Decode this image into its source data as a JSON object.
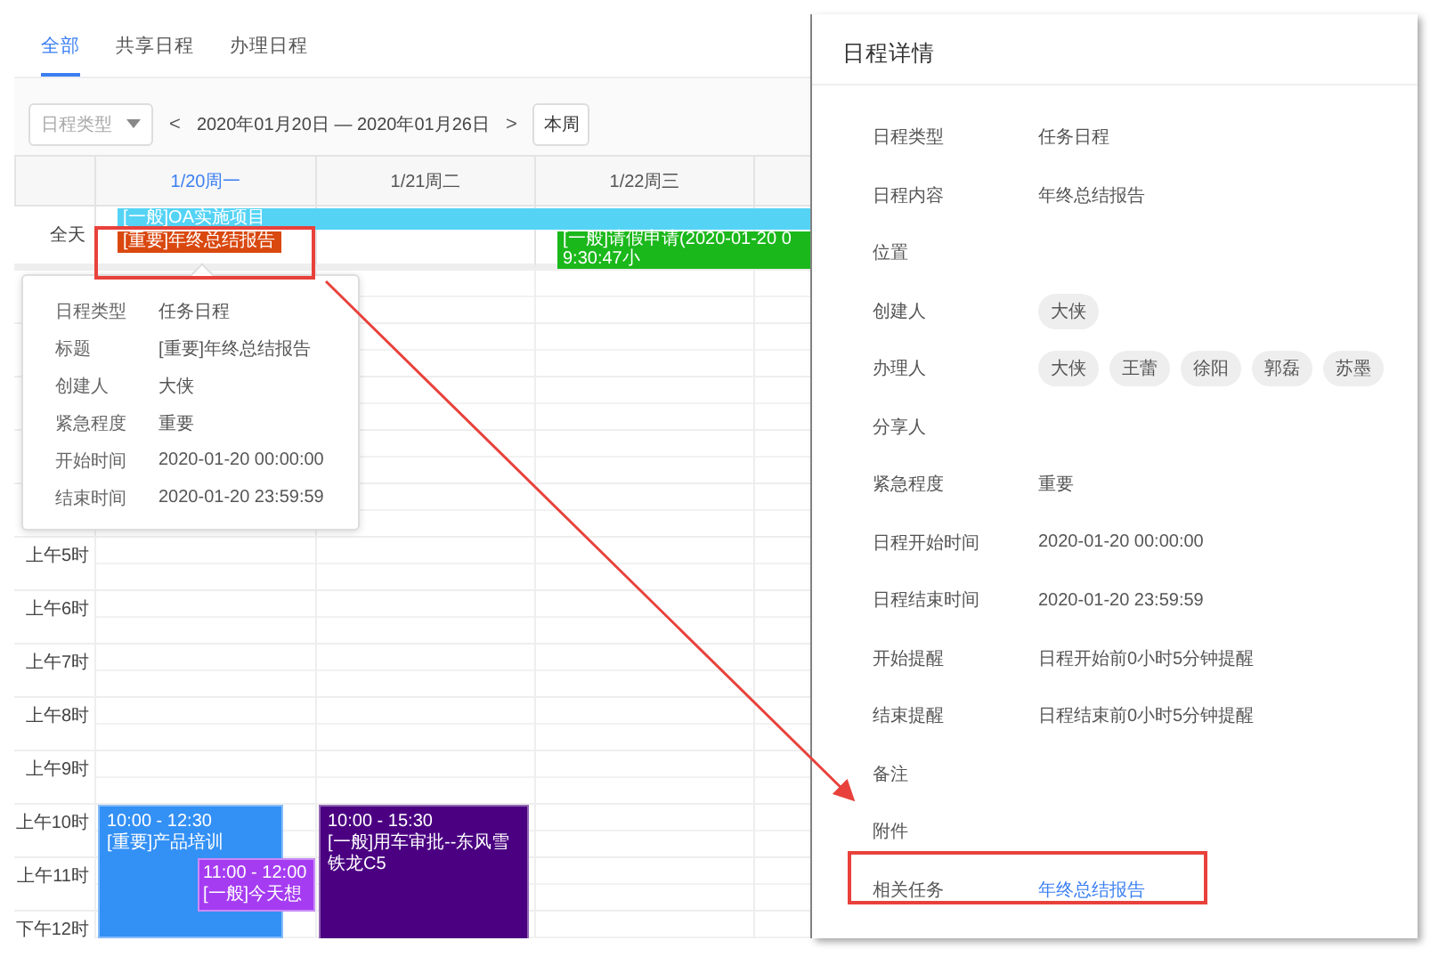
{
  "calendar": {
    "tabs": [
      {
        "label": "全部",
        "selected": true
      },
      {
        "label": "共享日程",
        "selected": false
      },
      {
        "label": "办理日程",
        "selected": false
      }
    ],
    "toolbar": {
      "type_filter": {
        "placeholder": "日程类型"
      },
      "prev": "<",
      "range": "2020年01月20日 — 2020年01月26日",
      "next": ">",
      "this_week": "本周"
    },
    "all_day_label": "全天",
    "days": [
      {
        "label": "1/20周一",
        "today": true,
        "all_day_events": [
          {
            "text": "[一般]OA实施项目",
            "color": "#55d3f5",
            "top_row": true,
            "extends": true
          },
          {
            "text": "[重要]年终总结报告",
            "color": "#d9480f",
            "top_row": false,
            "extends": false
          }
        ],
        "events": [
          {
            "time": "10:00 - 12:30",
            "title": "[重要]产品培训",
            "color": "#3390f5"
          },
          {
            "time": "11:00 - 12:00",
            "title": "[一般]今天想",
            "color": "#a63cf2"
          }
        ]
      },
      {
        "label": "1/21周二",
        "today": false,
        "events": [
          {
            "time": "10:00 - 15:30",
            "title": "[一般]用车审批--东风雪铁龙C5",
            "color": "#4b0082"
          }
        ]
      },
      {
        "label": "1/22周三",
        "today": false,
        "all_day_events": [
          {
            "text": "[一般]请假申请(2020-01-20 09:30:47小",
            "color": "#1bb81b",
            "top_row": false,
            "extends": true
          }
        ]
      }
    ],
    "hours": [
      "上午5时",
      "上午6时",
      "上午7时",
      "上午8时",
      "上午9时",
      "上午10时",
      "上午11时",
      "下午12时"
    ],
    "popover": {
      "fields": [
        {
          "label": "日程类型",
          "value": "任务日程"
        },
        {
          "label": "标题",
          "value": "[重要]年终总结报告"
        },
        {
          "label": "创建人",
          "value": "大侠"
        },
        {
          "label": "紧急程度",
          "value": "重要"
        },
        {
          "label": "开始时间",
          "value": "2020-01-20 00:00:00"
        },
        {
          "label": "结束时间",
          "value": "2020-01-20 23:59:59"
        }
      ]
    }
  },
  "detail_panel": {
    "title": "日程详情",
    "fields": [
      {
        "label": "日程类型",
        "kind": "text",
        "value": "任务日程"
      },
      {
        "label": "日程内容",
        "kind": "text",
        "value": "年终总结报告"
      },
      {
        "label": "位置",
        "kind": "text"
      },
      {
        "label": "创建人",
        "kind": "chips",
        "chips": [
          "大侠"
        ]
      },
      {
        "label": "办理人",
        "kind": "chips",
        "chips": [
          "大侠",
          "王蕾",
          "徐阳",
          "郭磊",
          "苏墨"
        ]
      },
      {
        "label": "分享人",
        "kind": "text"
      },
      {
        "label": "紧急程度",
        "kind": "text",
        "value": "重要"
      },
      {
        "label": "日程开始时间",
        "kind": "text",
        "value": "2020-01-20 00:00:00"
      },
      {
        "label": "日程结束时间",
        "kind": "text",
        "value": "2020-01-20 23:59:59"
      },
      {
        "label": "开始提醒",
        "kind": "text",
        "value": "日程开始前0小时5分钟提醒"
      },
      {
        "label": "结束提醒",
        "kind": "text",
        "value": "日程结束前0小时5分钟提醒"
      },
      {
        "label": "备注",
        "kind": "text"
      },
      {
        "label": "附件",
        "kind": "text"
      },
      {
        "label": "相关任务",
        "kind": "link",
        "value": "年终总结报告"
      }
    ]
  }
}
